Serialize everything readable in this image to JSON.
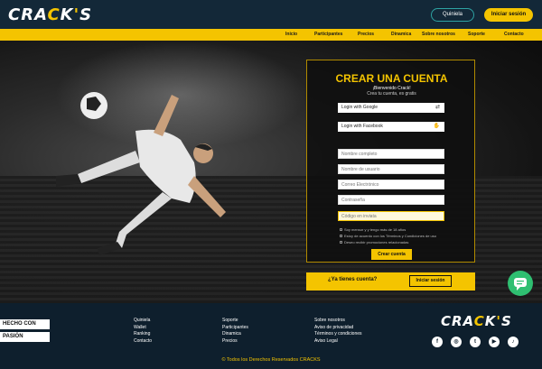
{
  "header": {
    "logo": "CRACKS",
    "quiniela_label": "Quiniela",
    "login_label": "Iniciar sesión"
  },
  "nav": [
    "Inicio",
    "Participantes",
    "Precios",
    "Dinamica",
    "Sobre nosotros",
    "Soporte",
    "Contacto"
  ],
  "form": {
    "title": "CREAR UNA CUENTA",
    "welcome": "¡Bienvenido Crack!",
    "subtitle": "Crea tu cuenta, es gratis",
    "google_label": "Login with Google",
    "facebook_label": "Login with Facebook",
    "name_placeholder": "Nombre completo",
    "user_placeholder": "Nombre de usuario",
    "email_placeholder": "Correo Electrónico",
    "password_placeholder": "Contraseña",
    "code_placeholder": "Código en inviata",
    "check_age": "Soy mensor y y tengo más de 18 años",
    "check_terms": "Estoy de acuerdo con los Términos y Condiciones de uso",
    "check_promo": "Deseo recibir promociones relacionadas",
    "create_label": "Crear cuenta"
  },
  "have_account": {
    "question": "¿Ya tienes cuenta?",
    "button": "Iniciar sesión"
  },
  "footer": {
    "badge1": "HECHO CON",
    "badge2": "PASIÓN",
    "col1": [
      "Quiniela",
      "Wallet",
      "Ranking",
      "Contacto"
    ],
    "col2": [
      "Soporte",
      "Participantes",
      "Dinamica",
      "Precios"
    ],
    "col3": [
      "Sobre nosotros",
      "Aviso de privacidad",
      "Términos y condiciones",
      "Aviso Legal"
    ],
    "logo": "CRACKS",
    "copyright": "© Todos los Derechos Reservados CRACKS",
    "social_icons": [
      "facebook-icon",
      "instagram-icon",
      "twitter-icon",
      "youtube-icon",
      "tiktok-icon"
    ]
  },
  "colors": {
    "accent": "#f4c400",
    "navy": "#0e1f2d",
    "teal": "#2ea3a3",
    "chat": "#2fbf71"
  }
}
